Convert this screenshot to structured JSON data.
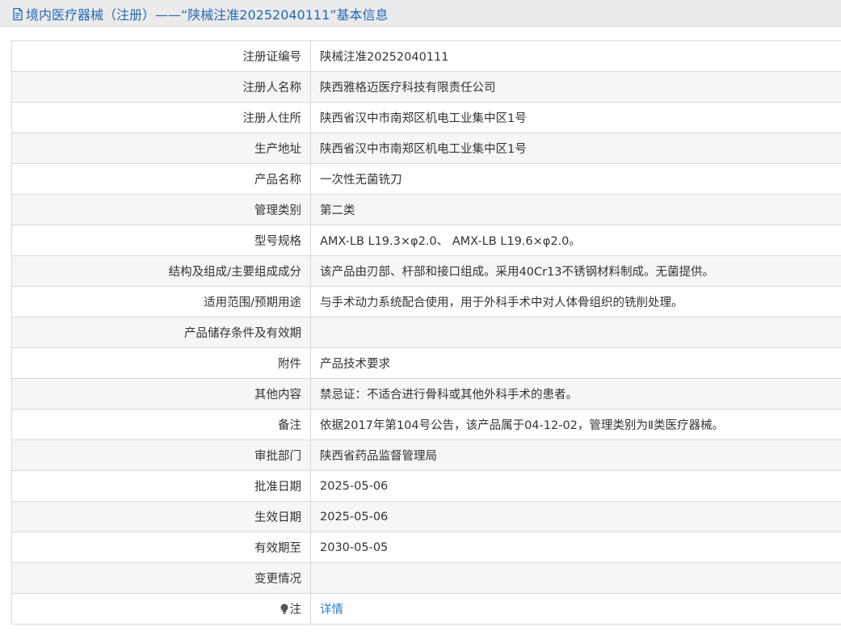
{
  "header": {
    "title": "境内医疗器械（注册）——“陕械注准20252040111”基本信息",
    "icon": "document-icon",
    "accent_color": "#2469b2"
  },
  "rows": [
    {
      "label": "注册证编号",
      "value": "陕械注准20252040111"
    },
    {
      "label": "注册人名称",
      "value": "陕西雅格迈医疗科技有限责任公司"
    },
    {
      "label": "注册人住所",
      "value": "陕西省汉中市南郑区机电工业集中区1号"
    },
    {
      "label": "生产地址",
      "value": "陕西省汉中市南郑区机电工业集中区1号"
    },
    {
      "label": "产品名称",
      "value": "一次性无菌铣刀"
    },
    {
      "label": "管理类别",
      "value": "第二类"
    },
    {
      "label": "型号规格",
      "value": "AMX-LB L19.3×φ2.0、 AMX-LB L19.6×φ2.0。"
    },
    {
      "label": "结构及组成/主要组成成分",
      "value": "该产品由刃部、杆部和接口组成。采用40Cr13不锈钢材料制成。无菌提供。"
    },
    {
      "label": "适用范围/预期用途",
      "value": "与手术动力系统配合使用，用于外科手术中对人体骨组织的铣削处理。"
    },
    {
      "label": "产品储存条件及有效期",
      "value": ""
    },
    {
      "label": "附件",
      "value": "产品技术要求"
    },
    {
      "label": "其他内容",
      "value": "禁忌证：不适合进行骨科或其他外科手术的患者。"
    },
    {
      "label": "备注",
      "value": "依据2017年第104号公告，该产品属于04-12-02，管理类别为Ⅱ类医疗器械。"
    },
    {
      "label": "审批部门",
      "value": "陕西省药品监督管理局"
    },
    {
      "label": "批准日期",
      "value": "2025-05-06"
    },
    {
      "label": "生效日期",
      "value": "2025-05-06"
    },
    {
      "label": "有效期至",
      "value": "2030-05-05"
    },
    {
      "label": "变更情况",
      "value": ""
    }
  ],
  "note": {
    "label": "注",
    "icon": "lightbulb-icon",
    "link_text": "详情",
    "link_color": "#2a7fd0"
  }
}
